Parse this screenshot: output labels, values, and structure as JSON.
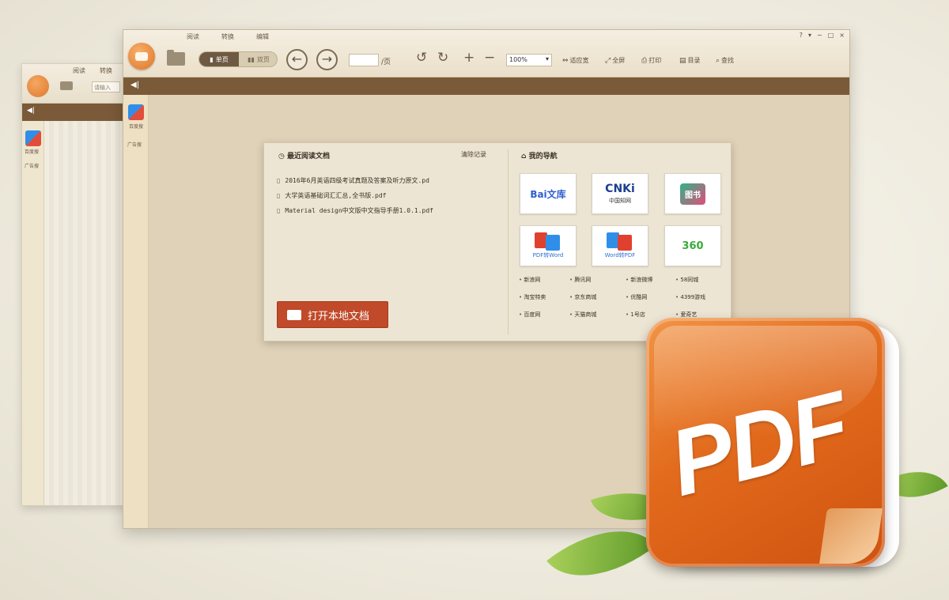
{
  "back_window": {
    "tabs": [
      "阅读",
      "转换"
    ],
    "page_field": "请输入",
    "collapse": "◀|",
    "sidebar_item": "百度搜",
    "sidebar_sub": "广告搜"
  },
  "menu_tabs": [
    "阅读",
    "转换",
    "编辑"
  ],
  "toolbar": {
    "single_page": "单页",
    "double_page": "双页",
    "prev": "←",
    "next": "→",
    "page_suffix": "/页",
    "rotate_left": "↺",
    "rotate_right": "↻",
    "zoom_in": "+",
    "zoom_out": "−",
    "zoom_value": "100%",
    "fit_width": "适应宽",
    "fullscreen": "全屏",
    "find": "打印",
    "bookmark": "目录",
    "search": "查找"
  },
  "window_controls": [
    "?",
    "▾",
    "−",
    "□",
    "×"
  ],
  "nav_bar": {
    "collapse": "◀|"
  },
  "sidebar": {
    "item": "百度搜",
    "sub": "广告搜"
  },
  "panel": {
    "recent_title": "最近阅读文档",
    "clear_history": "清除记录",
    "recent_files": [
      "2016年6月英语四级考试真题及答案及听力原文.pd",
      "大学英语基础词汇汇总,全书版.pdf",
      "Material design中文版中文指导手册1.0.1.pdf"
    ],
    "open_button": "打开本地文档",
    "nav_title": "我的导航",
    "tiles": [
      {
        "mark": "Bai文库",
        "cap": ""
      },
      {
        "mark": "CNKi",
        "cap": "中国知网"
      },
      {
        "mark": "图书",
        "cap": ""
      },
      {
        "mark": "",
        "cap": "PDF转Word"
      },
      {
        "mark": "",
        "cap": "Word转PDF"
      },
      {
        "mark": "360",
        "cap": ""
      }
    ],
    "links": [
      [
        "新浪网",
        "腾讯网",
        "新浪微博",
        "58同城"
      ],
      [
        "淘宝特卖",
        "京东商城",
        "优酷网",
        "4399游戏"
      ],
      [
        "百度网",
        "天猫商城",
        "1号店",
        "爱奇艺"
      ]
    ]
  },
  "big_icon": {
    "label": "PDF"
  },
  "colors": {
    "accent": "#c04a29",
    "brown_bar": "#7a5a38",
    "icon_orange": "#e26a1c"
  }
}
